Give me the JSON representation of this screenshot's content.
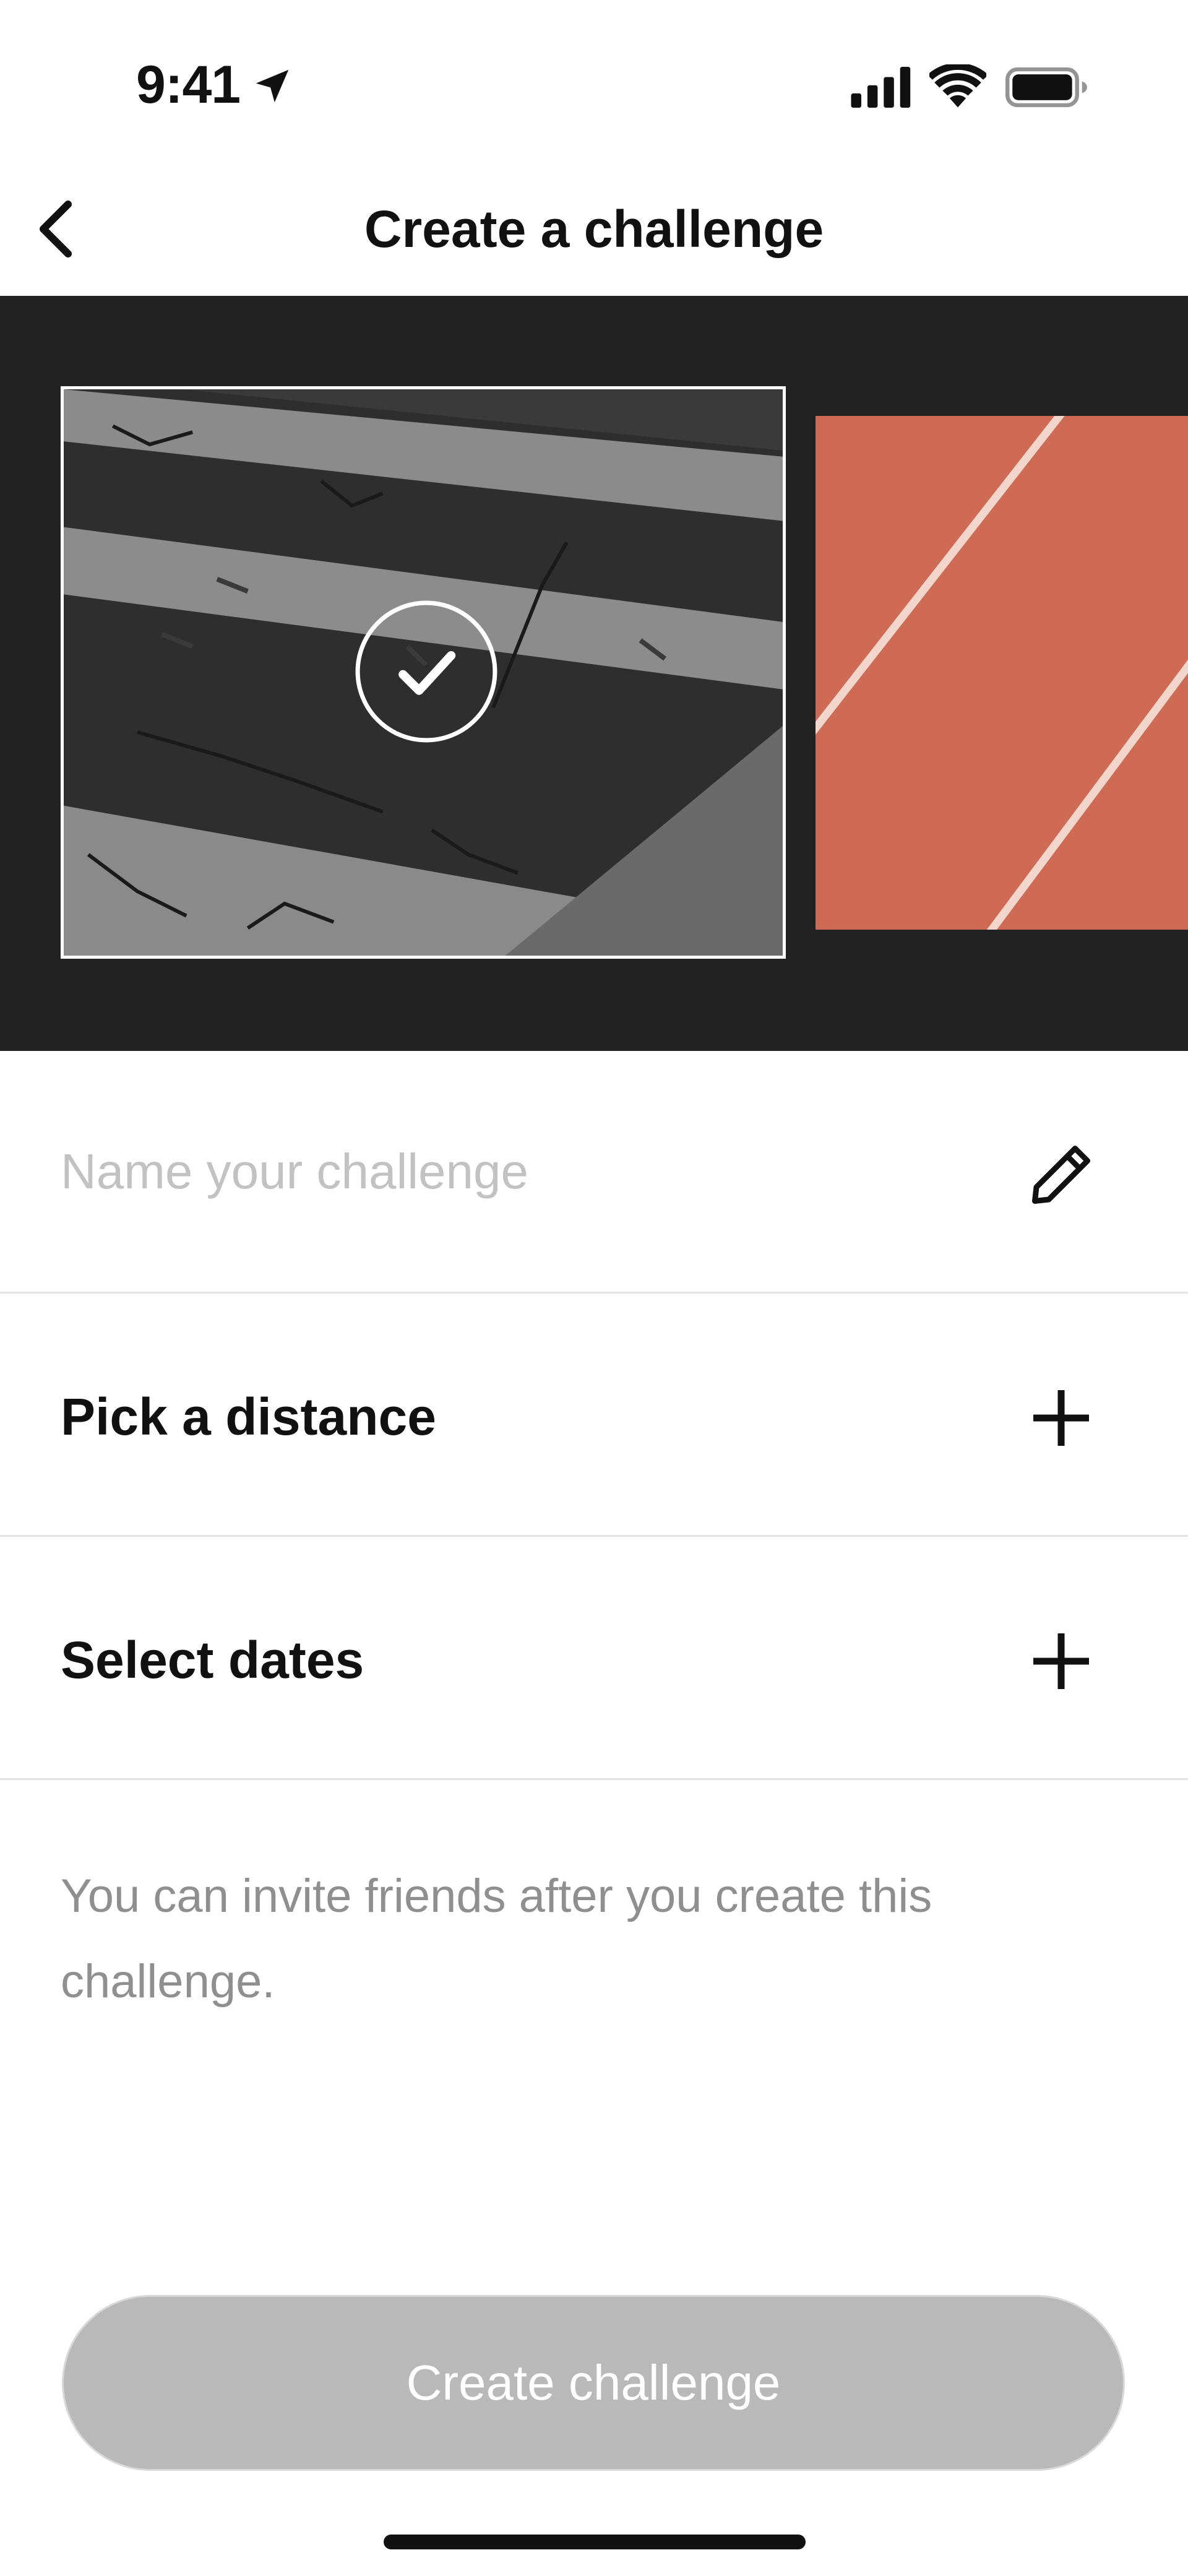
{
  "status_bar": {
    "time": "9:41",
    "icons": [
      "location-arrow-icon",
      "cellular-signal-icon",
      "wifi-icon",
      "battery-icon"
    ]
  },
  "nav": {
    "title": "Create a challenge",
    "back_icon": "chevron-left-icon"
  },
  "carousel": {
    "images": [
      {
        "name": "asphalt-crosswalk",
        "selected": true
      },
      {
        "name": "running-track",
        "selected": false
      }
    ],
    "selected_icon": "checkmark-circle-icon",
    "colors": {
      "background": "#222222",
      "track": "#cf6a55"
    }
  },
  "form": {
    "name_placeholder": "Name your challenge",
    "name_value": "",
    "name_icon": "pencil-icon",
    "distance_label": "Pick a distance",
    "dates_label": "Select dates",
    "add_icon": "plus-icon"
  },
  "info_text": "You can invite friends after you create this challenge.",
  "create_button_label": "Create challenge",
  "colors": {
    "button_disabled": "#b9b9b9",
    "placeholder": "#c2c2c2",
    "info_text": "#8f8f8f"
  }
}
